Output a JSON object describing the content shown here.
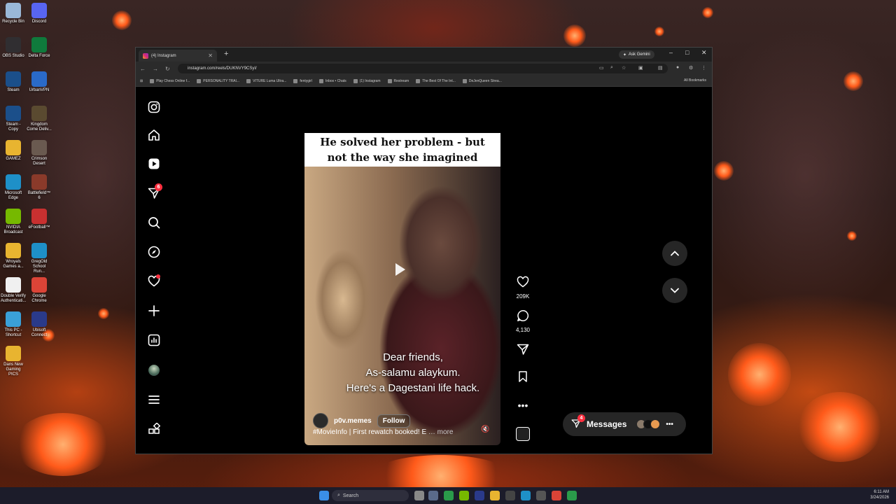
{
  "desktop": {
    "icons": [
      {
        "label": "Recycle Bin",
        "icon": "recycle-bin-icon",
        "color": "#9ab8d8"
      },
      {
        "label": "Discord",
        "icon": "discord-icon",
        "color": "#5865f2"
      },
      {
        "label": "OBS Studio",
        "icon": "obs-icon",
        "color": "#302e31"
      },
      {
        "label": "Delta Force",
        "icon": "delta-force-icon",
        "color": "#0f7a3c"
      },
      {
        "label": "Steam",
        "icon": "steam-icon",
        "color": "#1b4f8a"
      },
      {
        "label": "UrbanVPN",
        "icon": "urbanvpn-icon",
        "color": "#2a6ac8"
      },
      {
        "label": "Steam - Copy",
        "icon": "steam-icon",
        "color": "#1b4f8a"
      },
      {
        "label": "Kingdom Come Deliv...",
        "icon": "kingdom-come-icon",
        "color": "#5a4a30"
      },
      {
        "label": "GAMEZ",
        "icon": "folder-icon",
        "color": "#e8b430"
      },
      {
        "label": "Crimson Desert",
        "icon": "crimson-desert-icon",
        "color": "#6a5a50"
      },
      {
        "label": "Microsoft Edge",
        "icon": "edge-icon",
        "color": "#1e90c8"
      },
      {
        "label": "Battlefield™ 6",
        "icon": "battlefield-icon",
        "color": "#8a3a2a"
      },
      {
        "label": "NVIDIA Broadcast",
        "icon": "nvidia-icon",
        "color": "#76b900"
      },
      {
        "label": "eFootball™",
        "icon": "efootball-icon",
        "color": "#c83030"
      },
      {
        "label": "Wroyals Games a...",
        "icon": "folder-icon",
        "color": "#e8b430"
      },
      {
        "label": "GregOld School Run...",
        "icon": "edge-icon",
        "color": "#1e90c8"
      },
      {
        "label": "Double Verify Authenticati...",
        "icon": "document-icon",
        "color": "#f0f0f0"
      },
      {
        "label": "Google Chrome",
        "icon": "chrome-icon",
        "color": "#db4437"
      },
      {
        "label": "This PC - Shortcut",
        "icon": "this-pc-icon",
        "color": "#3aa0d8"
      },
      {
        "label": "Ubisoft Connect",
        "icon": "ubisoft-icon",
        "color": "#2a3a8a"
      },
      {
        "label": "Dans New Gaming PICS",
        "icon": "folder-icon",
        "color": "#e8b430"
      }
    ]
  },
  "browser": {
    "tab_title": "(4) Instagram",
    "new_tab_glyph": "+",
    "ask_gemini": "Ask Gemini",
    "url": "instagram.com/reels/DUKNVY9CSyI/",
    "bookmarks": [
      "Play Chess Online f...",
      "PERSONALITY TRAI...",
      "VITURE Luma Ultra...",
      "fentygirl",
      "Inbox • Chats",
      "(1) Instagram",
      "Restream",
      "The Best Of The Int...",
      "DeJenQueen Strea..."
    ],
    "all_bookmarks": "All Bookmarks",
    "window_controls": {
      "minimize": "–",
      "maximize": "□",
      "close": "✕"
    }
  },
  "sidebar": {
    "notifications_badge": "6"
  },
  "reel": {
    "caption": "He solved her problem - but not the way she imagined",
    "subtitle_lines": [
      "Dear friends,",
      "As-salamu alaykum.",
      "Here's a Dagestani life hack."
    ],
    "username": "p0v.memes",
    "follow_label": "Follow",
    "description": "#MovieInfo | First rewatch booked! E",
    "more_label": "… more",
    "likes": "209K",
    "comments": "4,130"
  },
  "messages": {
    "label": "Messages",
    "badge": "4"
  },
  "taskbar": {
    "search_placeholder": "Search",
    "time": "6:11 AM",
    "date": "3/24/2026"
  }
}
